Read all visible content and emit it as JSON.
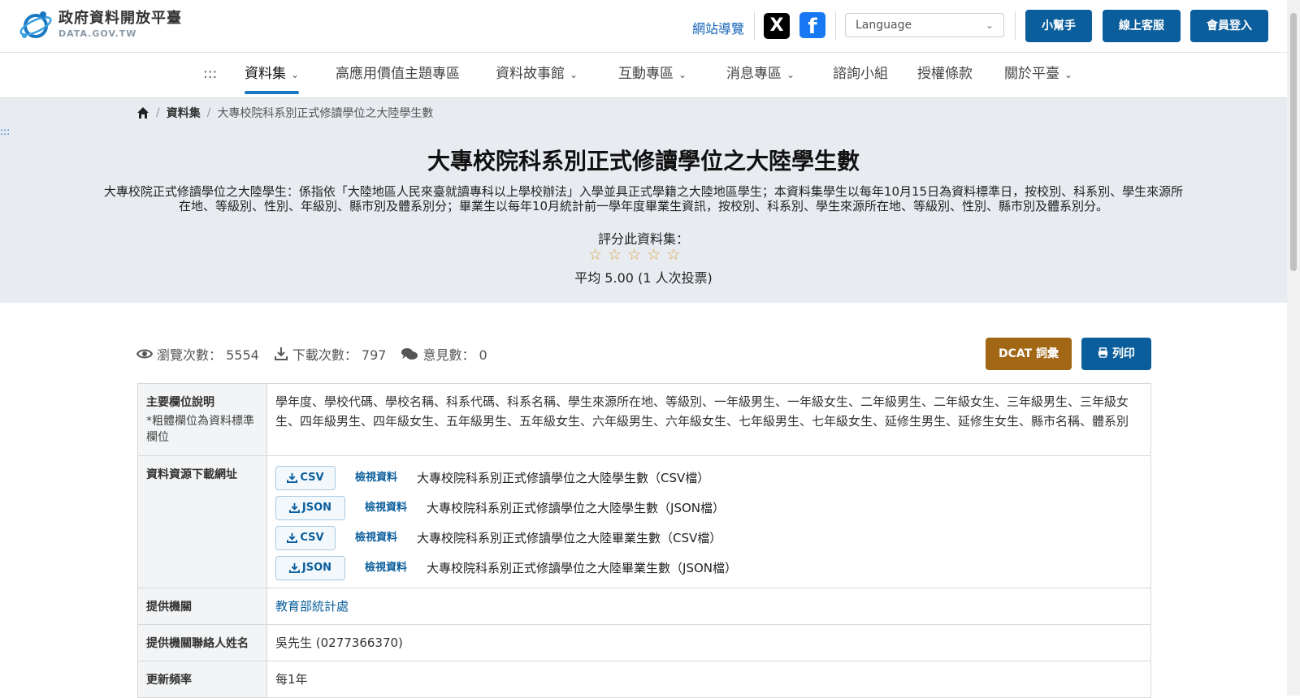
{
  "header": {
    "logo_title": "政府資料開放平臺",
    "logo_sub": "DATA.GOV.TW",
    "sitemap": "網站導覽",
    "social_x": "X",
    "social_fb": "f",
    "language_placeholder": "Language",
    "btn_helper": "小幫手",
    "btn_service": "線上客服",
    "btn_login": "會員登入"
  },
  "nav": {
    "accesskey": ":::",
    "items": [
      {
        "label": "資料集"
      },
      {
        "label": "高應用價值主題專區"
      },
      {
        "label": "資料故事館"
      },
      {
        "label": "互動專區"
      },
      {
        "label": "消息專區"
      },
      {
        "label": "諮詢小組"
      },
      {
        "label": "授權條款"
      },
      {
        "label": "關於平臺"
      }
    ]
  },
  "breadcrumb": {
    "items": [
      "資料集",
      "大專校院科系別正式修讀學位之大陸學生數"
    ]
  },
  "hero": {
    "accesskey": ":::",
    "title": "大專校院科系別正式修讀學位之大陸學生數",
    "description": "大專校院正式修讀學位之大陸學生：係指依「大陸地區人民來臺就讀專科以上學校辦法」入學並具正式學籍之大陸地區學生；本資料集學生以每年10月15日為資料標準日，按校別、科系別、學生來源所在地、等級別、性別、年級別、縣市別及體系別分；畢業生以每年10月統計前一學年度畢業生資訊，按校別、科系別、學生來源所在地、等級別、性別、縣市別及體系別分。",
    "rate_label": "評分此資料集：",
    "star_count": 5,
    "rate_avg": "平均 5.00 (1 人次投票)"
  },
  "stats": {
    "views": "瀏覽次數： 5554",
    "downloads": "下載次數： 797",
    "comments": "意見數： 0"
  },
  "actions": {
    "dcat": "DCAT 詞彙",
    "print": "列印"
  },
  "table": {
    "fields_label": "主要欄位說明",
    "fields_note": "*粗體欄位為資料標準欄位",
    "fields_value": "學年度、學校代碼、學校名稱、科系代碼、科系名稱、學生來源所在地、等級別、一年級男生、一年級女生、二年級男生、二年級女生、三年級男生、三年級女生、四年級男生、四年級女生、五年級男生、五年級女生、六年級男生、六年級女生、七年級男生、七年級女生、延修生男生、延修生女生、縣市名稱、體系別",
    "resources_label": "資料資源下載網址",
    "resources": [
      {
        "format": "CSV",
        "view": "檢視資料",
        "name": "大專校院科系別正式修讀學位之大陸學生數（CSV檔）"
      },
      {
        "format": "JSON",
        "view": "檢視資料",
        "name": "大專校院科系別正式修讀學位之大陸學生數（JSON檔）"
      },
      {
        "format": "CSV",
        "view": "檢視資料",
        "name": "大專校院科系別正式修讀學位之大陸畢業生數（CSV檔）"
      },
      {
        "format": "JSON",
        "view": "檢視資料",
        "name": "大專校院科系別正式修讀學位之大陸畢業生數（JSON檔）"
      }
    ],
    "provider_label": "提供機關",
    "provider_value": "教育部統計處",
    "contact_label": "提供機關聯絡人姓名",
    "contact_value": "吳先生 (0277366370)",
    "freq_label": "更新頻率",
    "freq_value": "每1年"
  },
  "colors": {
    "primary": "#0b5e9c",
    "dcat": "#a16714",
    "hero_bg": "#e8ecf1",
    "star": "#d9a441"
  }
}
